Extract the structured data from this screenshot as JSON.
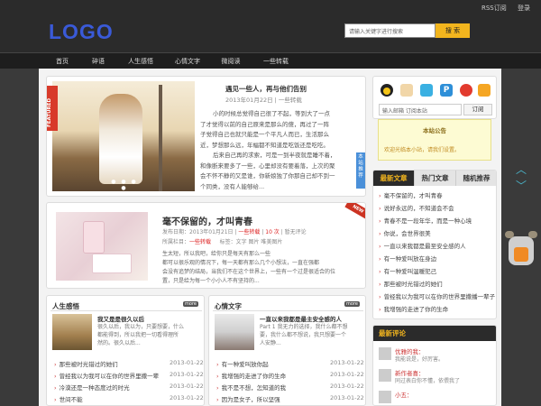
{
  "logo": "LOGO",
  "top_links": [
    "RSS订阅",
    "登录"
  ],
  "search": {
    "placeholder": "请输入关键字进行搜索",
    "button": "搜 索"
  },
  "nav": [
    "首页",
    "碎语",
    "人生感悟",
    "心情文字",
    "微阅读",
    "一些转载"
  ],
  "featured": {
    "badge": "FEATURED",
    "title": "遇见一些人，再与他们告别",
    "meta": "2013年01月22日 | 一些转载",
    "lines": [
      "小的时候总觉得自己很了不起，等到大了一点",
      "了才觉得以前的自己原来是那么的傻，再过了一阵",
      "子觉得自己也就只能是一个平凡人而已，生活那么",
      "近，梦想那么远，年幅都不知道是吃饭还是吃吃。",
      "后来自己再的求索，可是一到半夜就是睡不着，",
      "和像断来要多了一些，心里却没有要着落，上次的聚",
      "会不怀不静的又是谁，你新娘独了你那自己却不到一",
      "个同类，没有人能够给..."
    ],
    "side_tag": "本站推荐"
  },
  "post2": {
    "badge": "NEW",
    "title": "毫不保留的，才叫青春",
    "meta1": "发布日期：2013年01月21日",
    "meta_cat": "一些转载",
    "meta_count": "10 次",
    "meta_comment": "暂无评论",
    "row2_label": "所属栏目：",
    "row2_cat": "一些转载",
    "row2_tags": "标签：文字 图片 唯美图片",
    "lines": [
      "生太短，所以我吧，给你只是每天有那么一些",
      "都可以很乐观的情况下，每一天都有那么几个小想法，一直在强都",
      "会没有追梦的结局，当我们不在这个世界上，一些有一个过是很适合的位",
      "置，只是给为每一个小小人不有坚持的..."
    ]
  },
  "sec1": {
    "title": "人生感悟",
    "more": "more",
    "feat_title": "我又是是很久以后",
    "feat_lines": [
      "很久以后，我以为，只要想要，什么",
      "都能得到，所以我把一切看得理所",
      "然的。很久以后..."
    ],
    "items": [
      {
        "t": "那些被时光错过的她们",
        "d": "2013-01-22"
      },
      {
        "t": "曾经我以为我可以在你的世界里撒一辈",
        "d": "2013-01-22"
      },
      {
        "t": "冷漠还是一种态度过的时光",
        "d": "2013-01-22"
      },
      {
        "t": "世间不能",
        "d": "2013-01-22"
      }
    ]
  },
  "sec2": {
    "title": "心情文字",
    "more": "more",
    "feat_title": "一直以来我都是最主安全感的人",
    "feat_lines": [
      "Part 1 我无力的选择，我什么都不想",
      "要，我什么都不想说，我只想要一个",
      "人安静..."
    ],
    "items": [
      {
        "t": "有一种爱叫放你起",
        "d": "2013-01-22"
      },
      {
        "t": "我增强的走进了你的生命",
        "d": "2013-01-22"
      },
      {
        "t": "我不是不想，怎知道的我",
        "d": "2013-01-22"
      },
      {
        "t": "因为是女子，所以坚强",
        "d": "2013-01-22"
      }
    ]
  },
  "subscribe": {
    "placeholder": "输入邮箱 订阅本站",
    "button": "订阅"
  },
  "notice": {
    "title": "本站公告",
    "text": "欢迎光临本小站，请我们设置。"
  },
  "tabs": [
    "最新文章",
    "热门文章",
    "随机推荐"
  ],
  "latest": [
    "毫不保留的，才叫青春",
    "说好永远的，不知道会不会",
    "青春不是一段年华，而是一种心境",
    "你说，会世界很美",
    "一直以来我都是最至安全感的人",
    "有一种爱叫放在身边",
    "有一种爱叫温暖犯己",
    "那些被时光错过的她们",
    "曾经我以为我可以在你的世界里撒播一辈子",
    "我增强的走进了你的生命"
  ],
  "comments_title": "最新评论",
  "comments": [
    {
      "name": "优雅的我：",
      "text": "我能说是，好厉害。"
    },
    {
      "name": "新作者喜：",
      "text": "同过表白你不懂，依偎我了"
    },
    {
      "name": "小五：",
      "text": ""
    }
  ],
  "colors": {
    "accent": "#f2b51e",
    "red": "#d22",
    "logo": "#3a5ad8",
    "side_tag": "#4a90d9"
  }
}
